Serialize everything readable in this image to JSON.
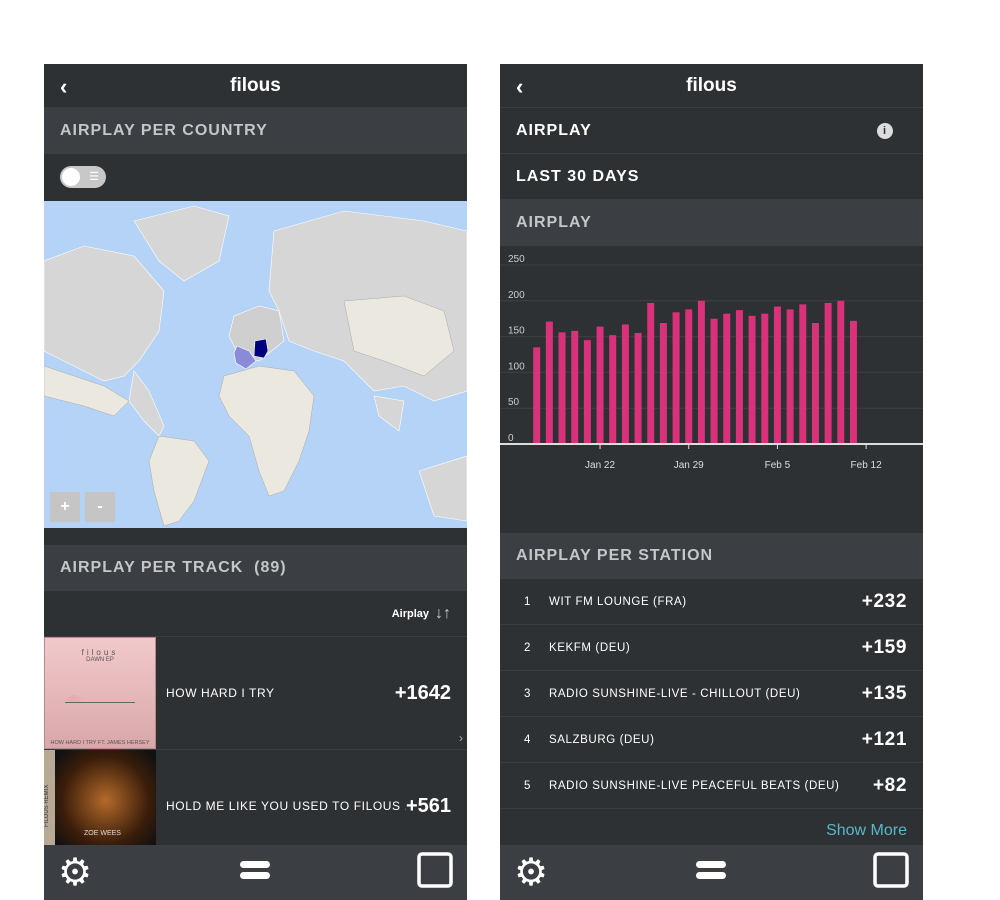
{
  "left": {
    "title": "filous",
    "country_section": "AIRPLAY PER COUNTRY",
    "map": {
      "highlighted": [
        {
          "country": "Germany",
          "color": "#00007f"
        },
        {
          "country": "France",
          "color": "#8a8ad8"
        }
      ],
      "zoom_in": "+",
      "zoom_out": "-"
    },
    "track_section": "AIRPLAY PER TRACK",
    "track_count": "(89)",
    "sort_label": "Airplay",
    "tracks": [
      {
        "name": "HOW HARD I TRY",
        "value": "+1642",
        "art": {
          "artist": "filous",
          "release": "DAWN EP",
          "caption": "HOW HARD I TRY FT. JAMES HERSEY"
        }
      },
      {
        "name": "HOLD ME LIKE YOU USED TO FILOUS ...",
        "value": "+561",
        "art": {
          "side": "FILOUS REMIX",
          "caption": "ZOE WEES"
        }
      }
    ]
  },
  "right": {
    "title": "filous",
    "airplay_row": "AIRPLAY",
    "period_row": "LAST 30 DAYS",
    "chart_section": "AIRPLAY",
    "station_section": "AIRPLAY PER STATION",
    "stations": [
      {
        "rank": "1",
        "name": "WIT FM LOUNGE (FRA)",
        "value": "+232"
      },
      {
        "rank": "2",
        "name": "KEKFM (DEU)",
        "value": "+159"
      },
      {
        "rank": "3",
        "name": "RADIO SUNSHINE-LIVE - CHILLOUT (DEU)",
        "value": "+135"
      },
      {
        "rank": "4",
        "name": "SALZBURG (DEU)",
        "value": "+121"
      },
      {
        "rank": "5",
        "name": "RADIO SUNSHINE-LIVE PEACEFUL BEATS (DEU)",
        "value": "+82"
      }
    ],
    "show_more": "Show More"
  },
  "nav_icons": [
    "gear-icon",
    "menu-icon",
    "square-icon"
  ],
  "chart_data": {
    "type": "bar",
    "x": [
      "Jan 17",
      "Jan 18",
      "Jan 19",
      "Jan 20",
      "Jan 21",
      "Jan 22",
      "Jan 23",
      "Jan 24",
      "Jan 25",
      "Jan 26",
      "Jan 27",
      "Jan 28",
      "Jan 29",
      "Jan 30",
      "Jan 31",
      "Feb 1",
      "Feb 2",
      "Feb 3",
      "Feb 4",
      "Feb 5",
      "Feb 6",
      "Feb 7",
      "Feb 8",
      "Feb 9",
      "Feb 10",
      "Feb 11"
    ],
    "values": [
      135,
      171,
      156,
      158,
      145,
      164,
      152,
      167,
      155,
      197,
      169,
      184,
      188,
      200,
      175,
      182,
      187,
      179,
      182,
      192,
      188,
      195,
      169,
      197,
      200,
      172
    ],
    "xticks": [
      "Jan 22",
      "Jan 29",
      "Feb 5",
      "Feb 12"
    ],
    "yticks": [
      "0",
      "50",
      "100",
      "150",
      "200",
      "250"
    ],
    "ylim": [
      0,
      250
    ],
    "grid": true,
    "color": "#d9317a"
  }
}
